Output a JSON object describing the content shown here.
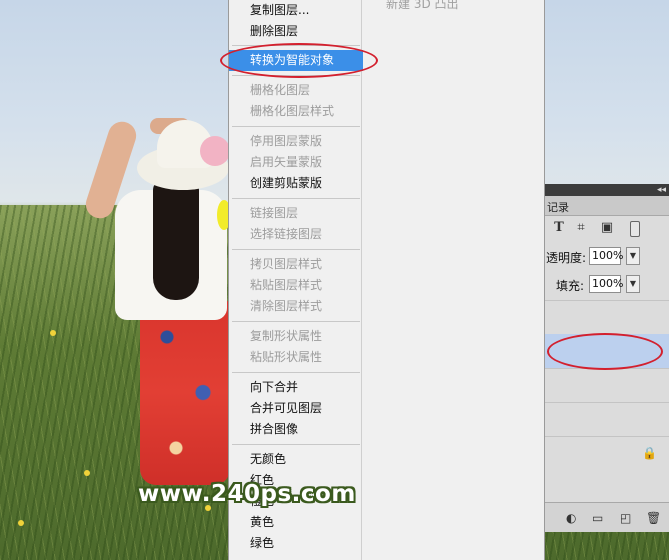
{
  "watermark": "www.240ps.com",
  "submenu_partial_text": "新建 3D 凸出",
  "context_menu": {
    "items": [
      {
        "label": "复制图层...",
        "disabled": false
      },
      {
        "label": "删除图层",
        "disabled": false
      },
      {
        "label": "转换为智能对象",
        "disabled": false,
        "highlighted": true
      },
      {
        "label": "栅格化图层",
        "disabled": true
      },
      {
        "label": "栅格化图层样式",
        "disabled": true
      },
      {
        "label": "停用图层蒙版",
        "disabled": true
      },
      {
        "label": "启用矢量蒙版",
        "disabled": true
      },
      {
        "label": "创建剪贴蒙版",
        "disabled": false
      },
      {
        "label": "链接图层",
        "disabled": true
      },
      {
        "label": "选择链接图层",
        "disabled": true
      },
      {
        "label": "拷贝图层样式",
        "disabled": true
      },
      {
        "label": "粘贴图层样式",
        "disabled": true
      },
      {
        "label": "清除图层样式",
        "disabled": true
      },
      {
        "label": "复制形状属性",
        "disabled": true
      },
      {
        "label": "粘贴形状属性",
        "disabled": true
      },
      {
        "label": "向下合并",
        "disabled": false
      },
      {
        "label": "合并可见图层",
        "disabled": false
      },
      {
        "label": "拼合图像",
        "disabled": false
      },
      {
        "label": "无颜色",
        "disabled": false
      },
      {
        "label": "红色",
        "disabled": false
      },
      {
        "label": "橙色",
        "disabled": false
      },
      {
        "label": "黄色",
        "disabled": false
      },
      {
        "label": "绿色",
        "disabled": false
      }
    ]
  },
  "layers_panel": {
    "tab_label": "记录",
    "opacity_label": "透明度:",
    "opacity_value": "100%",
    "fill_label": "填充:",
    "fill_value": "100%",
    "tool_icons": [
      "type-icon",
      "transform-icon",
      "smart-object-icon",
      "toggle-icon"
    ],
    "bottom_icons": [
      "adjustment-icon",
      "folder-icon",
      "new-layer-icon",
      "trash-icon"
    ]
  },
  "colors": {
    "menu_highlight": "#3b8fe8",
    "annotation_red": "#d3202e",
    "selected_layer": "#bcd0ee"
  }
}
